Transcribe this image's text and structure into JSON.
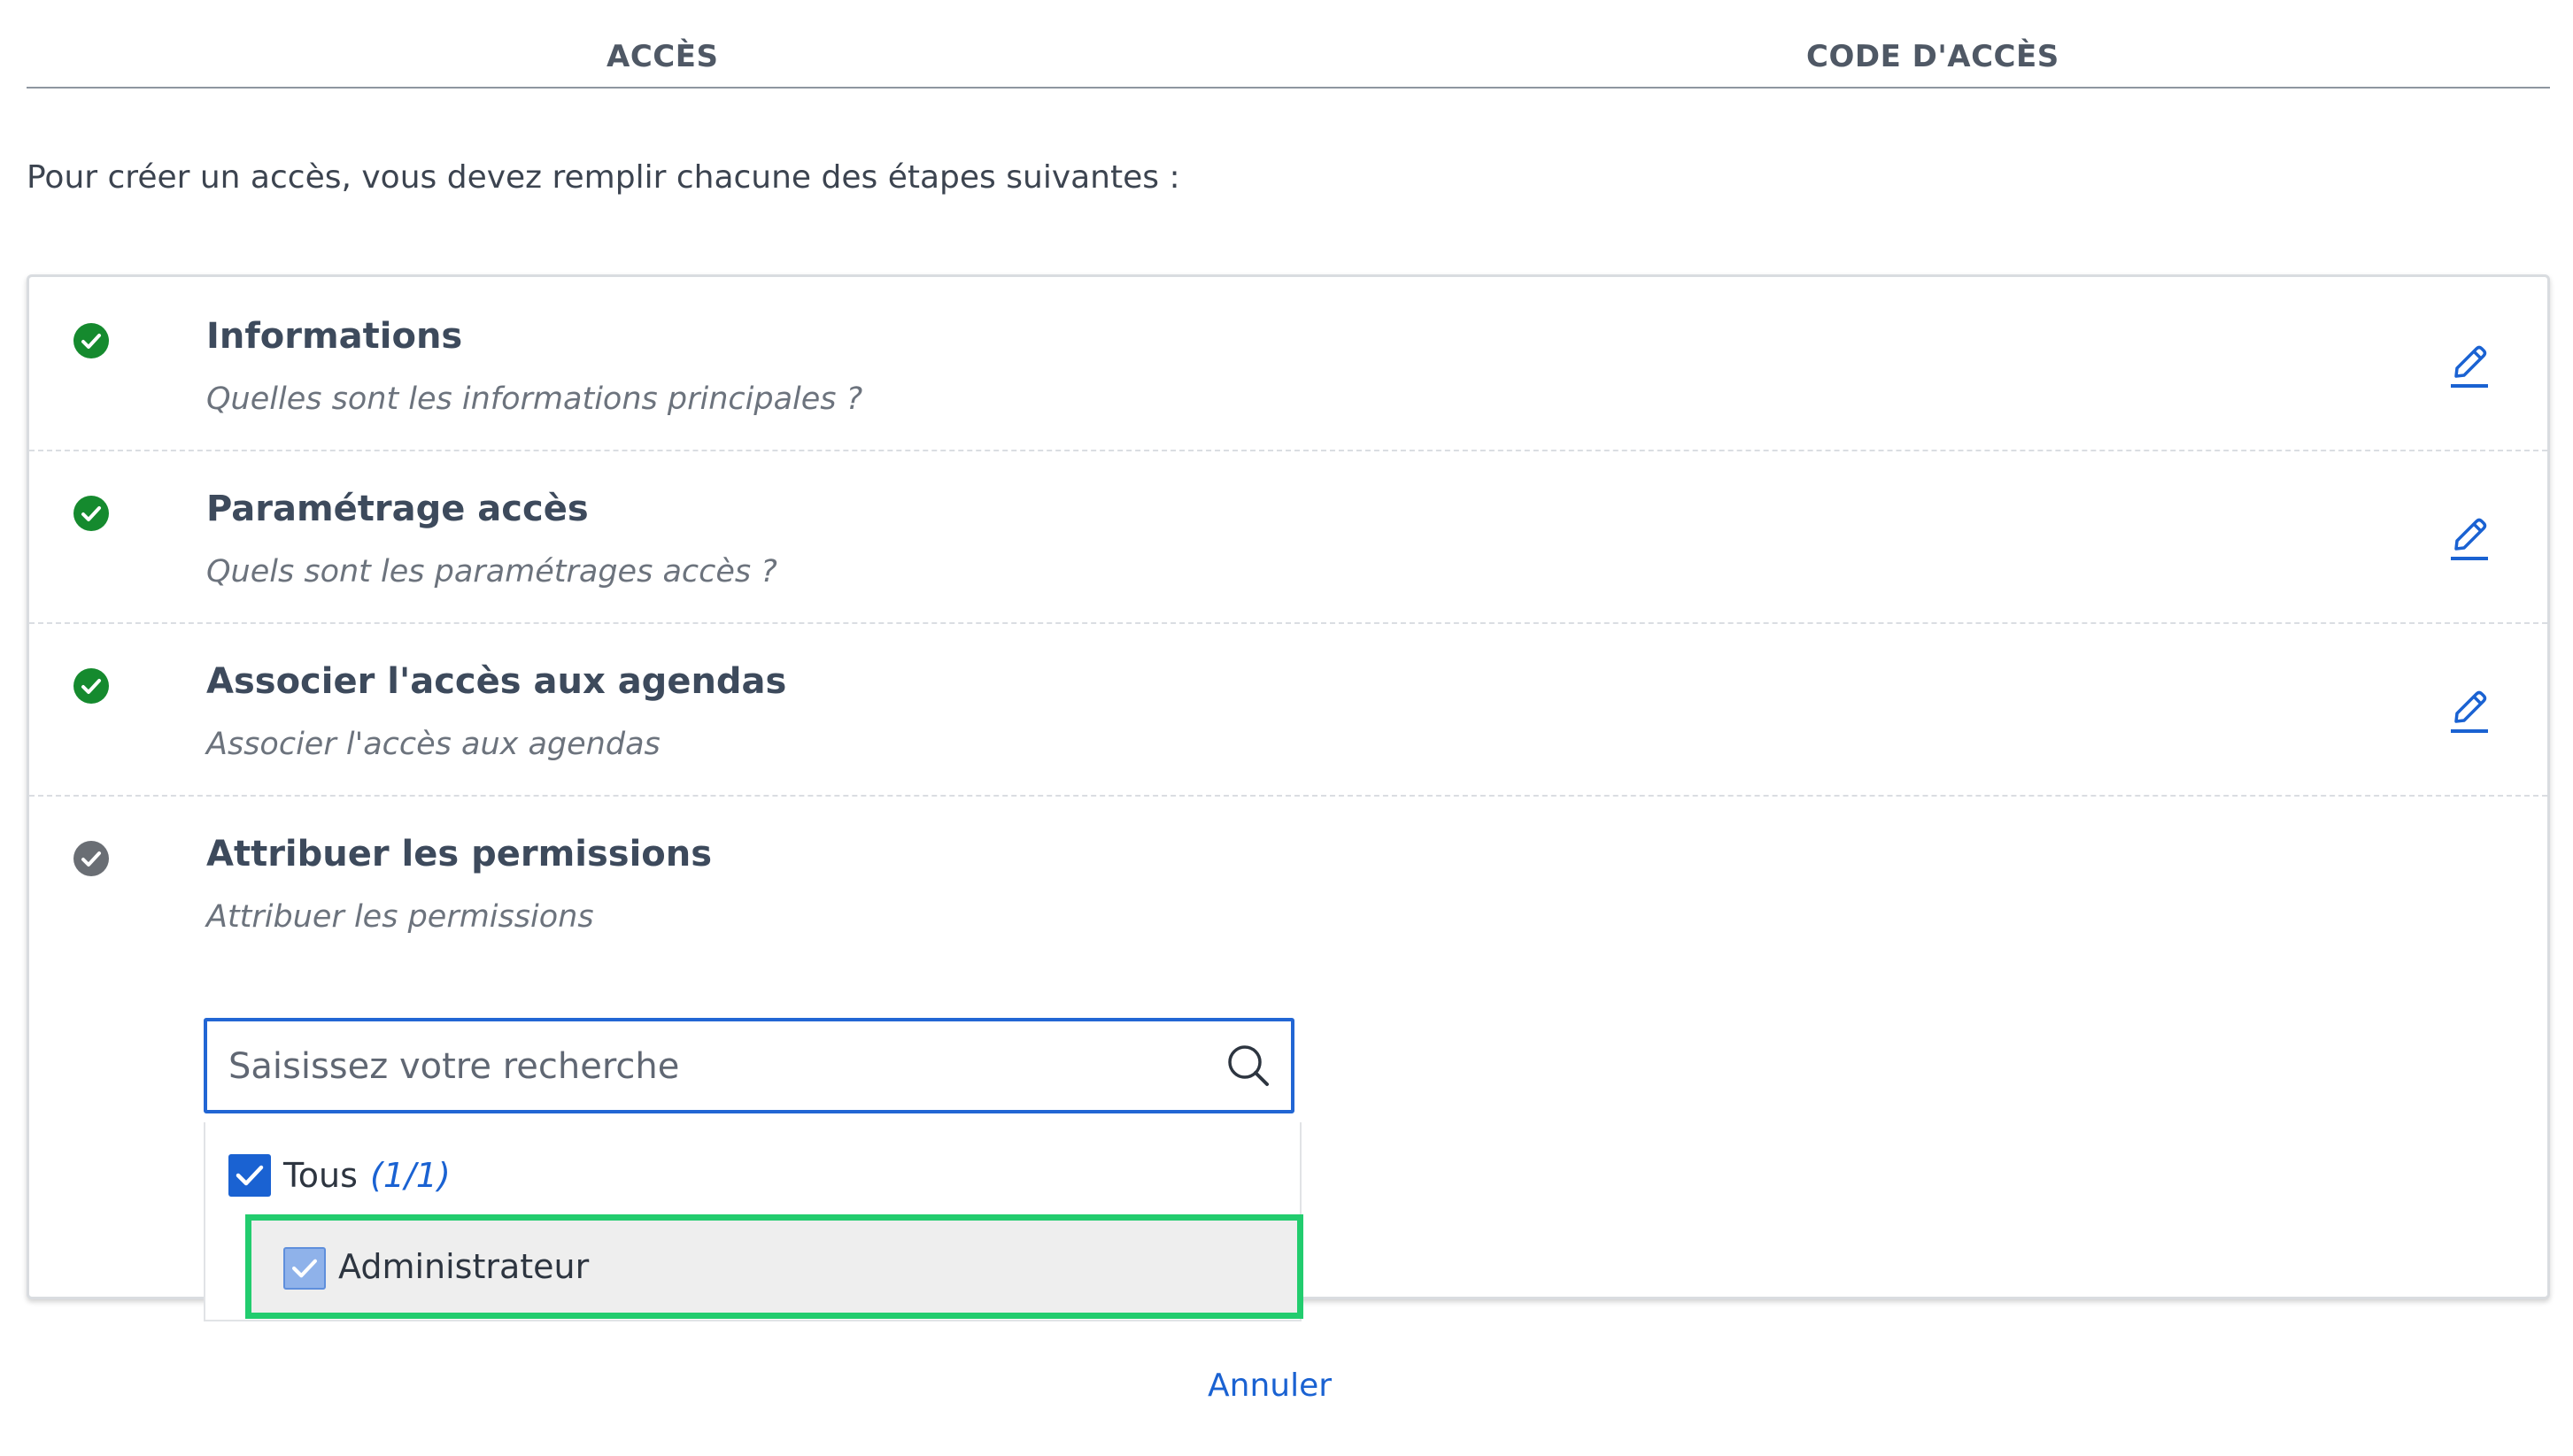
{
  "tabs": [
    {
      "label": "ACCÈS"
    },
    {
      "label": "CODE D'ACCÈS"
    }
  ],
  "intro": "Pour créer un accès, vous devez remplir chacune des étapes suivantes :",
  "steps": [
    {
      "title": "Informations",
      "subtitle": "Quelles sont les informations principales ?",
      "status": "done"
    },
    {
      "title": "Paramétrage accès",
      "subtitle": "Quels sont les paramétrages accès ?",
      "status": "done"
    },
    {
      "title": "Associer l'accès aux agendas",
      "subtitle": "Associer l'accès aux agendas",
      "status": "done"
    },
    {
      "title": "Attribuer les permissions",
      "subtitle": "Attribuer les permissions",
      "status": "current"
    }
  ],
  "search": {
    "placeholder": "Saisissez votre recherche",
    "value": ""
  },
  "options": {
    "all_label": "Tous",
    "all_count": "(1/1)",
    "items": [
      {
        "label": "Administrateur",
        "checked": true
      }
    ]
  },
  "cancel_label": "Annuler",
  "colors": {
    "done": "#158a2e",
    "current": "#6a6e74",
    "accent": "#1a62d2",
    "highlight": "#22cc6e"
  }
}
